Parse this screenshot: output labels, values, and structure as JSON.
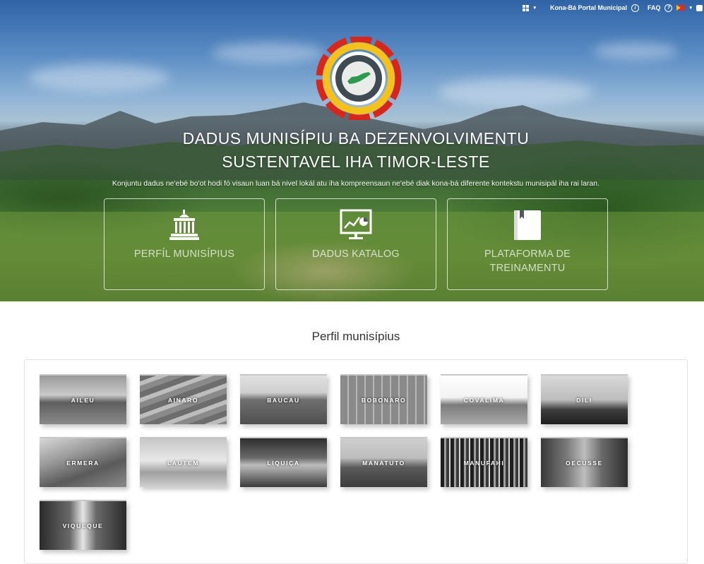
{
  "topbar": {
    "portal_label": "Kona-Bá Portal Municipal",
    "faq_label": "FAQ"
  },
  "hero": {
    "title_line1": "DADUS MUNISÍPIU BA DEZENVOLVIMENTU",
    "title_line2": "SUSTENTAVEL IHA TIMOR-LESTE",
    "subtitle": "Konjuntu dadus ne'ebé bo'ot hodi fó visaun luan bá nivel lokál atu iha kompreensaun ne'ebé diak kona-bá diferente kontekstu munisipál iha rai laran.",
    "cards": [
      {
        "label": "PERFÍL MUNISÍPIUS",
        "icon": "government-building-icon"
      },
      {
        "label": "DADUS KATALOG",
        "icon": "chart-presentation-icon"
      },
      {
        "label": "PLATAFORMA DE TREINAMENTU",
        "icon": "book-icon"
      }
    ]
  },
  "section": {
    "title": "Perfil munisípius"
  },
  "municipalities": [
    {
      "name": "AILEU"
    },
    {
      "name": "AINARO"
    },
    {
      "name": "BAUCAU"
    },
    {
      "name": "BOBONARO"
    },
    {
      "name": "COVALIMA"
    },
    {
      "name": "DILI"
    },
    {
      "name": "ERMERA"
    },
    {
      "name": "LAUTEM"
    },
    {
      "name": "LIQUIÇA"
    },
    {
      "name": "MANATUTO"
    },
    {
      "name": "MANUFAHI"
    },
    {
      "name": "OECUSSE"
    },
    {
      "name": "VIQUEQUE"
    }
  ]
}
